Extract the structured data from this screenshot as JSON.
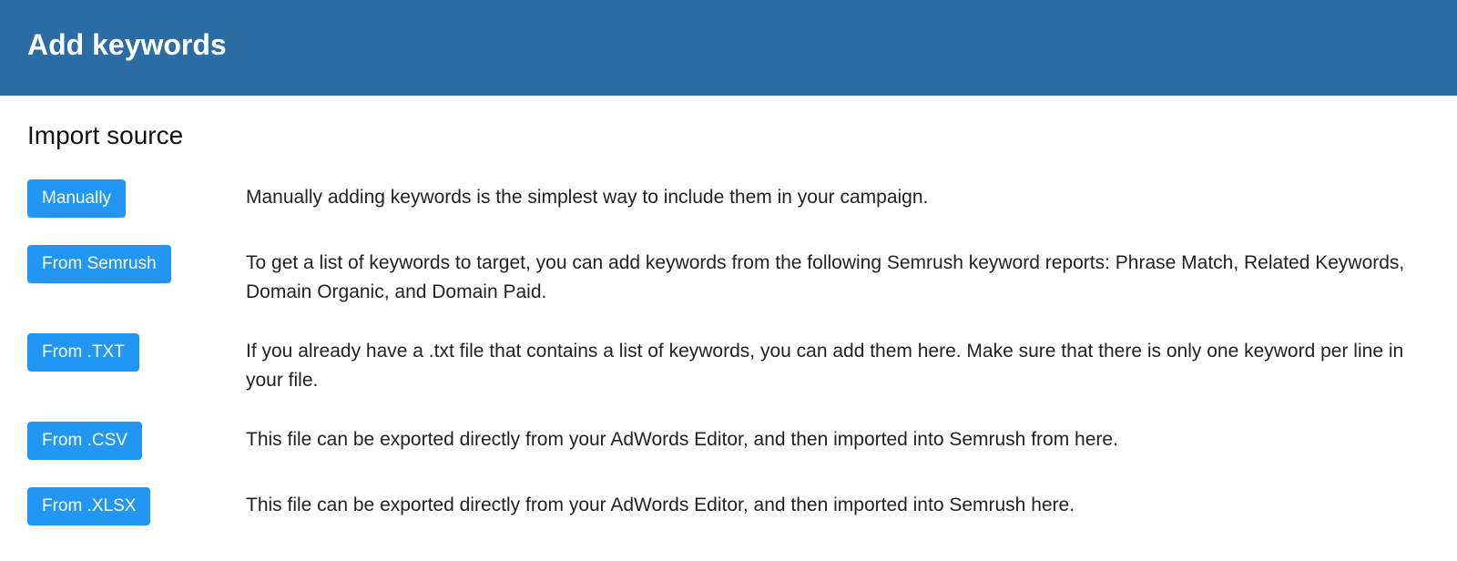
{
  "header": {
    "title": "Add keywords"
  },
  "section": {
    "title": "Import source"
  },
  "rows": [
    {
      "button": "Manually",
      "desc": "Manually adding keywords is the simplest way to include them in your campaign."
    },
    {
      "button": "From Semrush",
      "desc": "To get a list of keywords to target, you can add keywords from the following Semrush keyword reports: Phrase Match, Related Keywords, Domain Organic, and Domain Paid."
    },
    {
      "button": "From .TXT",
      "desc": "If you already have a .txt file that contains a list of keywords, you can add them here. Make sure that there is only one keyword per line in your file."
    },
    {
      "button": "From .CSV",
      "desc": "This file can be exported directly from your AdWords Editor, and then imported into Semrush from here."
    },
    {
      "button": "From .XLSX",
      "desc": "This file can be exported directly from your AdWords Editor, and then imported into Semrush here."
    }
  ]
}
